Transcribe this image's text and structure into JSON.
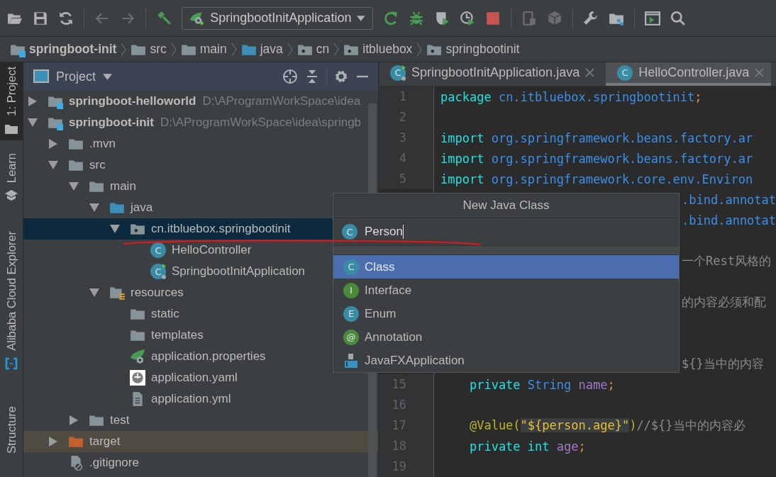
{
  "toolbar": [
    {
      "kind": "open",
      "disabled": false
    },
    {
      "kind": "save",
      "disabled": false
    },
    {
      "kind": "sync",
      "disabled": false
    },
    {
      "kind": "separator"
    },
    {
      "kind": "back",
      "disabled": true
    },
    {
      "kind": "forward",
      "disabled": true
    },
    {
      "kind": "separator"
    },
    {
      "kind": "build",
      "disabled": false
    },
    {
      "kind": "run-config",
      "label": "SpringbootInitApplication"
    },
    {
      "kind": "rerun",
      "disabled": false
    },
    {
      "kind": "debug",
      "disabled": false
    },
    {
      "kind": "coverage",
      "disabled": false
    },
    {
      "kind": "profile",
      "disabled": false
    },
    {
      "kind": "stop",
      "disabled": false
    },
    {
      "kind": "separator"
    },
    {
      "kind": "device",
      "disabled": true
    },
    {
      "kind": "package",
      "disabled": true
    },
    {
      "kind": "separator"
    },
    {
      "kind": "wrench",
      "disabled": false
    },
    {
      "kind": "structure",
      "disabled": false
    },
    {
      "kind": "separator"
    },
    {
      "kind": "terminal",
      "disabled": false
    },
    {
      "kind": "search",
      "disabled": false
    }
  ],
  "breadcrumbs": [
    {
      "label": "springboot-init",
      "kind": "module"
    },
    {
      "label": "src",
      "kind": "folder"
    },
    {
      "label": "main",
      "kind": "folder"
    },
    {
      "label": "java",
      "kind": "source-folder"
    },
    {
      "label": "cn",
      "kind": "package"
    },
    {
      "label": "itbluebox",
      "kind": "package"
    },
    {
      "label": "springbootinit",
      "kind": "package"
    }
  ],
  "tool_stripe": [
    {
      "label": "1: Project",
      "kind": "folder",
      "selected": true
    },
    {
      "label": "Learn",
      "kind": "learn",
      "selected": false
    },
    {
      "label": "Alibaba Cloud Explorer",
      "kind": "cloud",
      "selected": false
    },
    {
      "label": "Structure",
      "kind": "none",
      "selected": false
    }
  ],
  "project_panel": {
    "title": "Project",
    "tree": [
      {
        "label": "springboot-helloworld",
        "path": "D:\\AProgramWorkSpace\\idea",
        "kind": "module",
        "expanded": false,
        "selected": false
      },
      {
        "label": "springboot-init",
        "path": "D:\\AProgramWorkSpace\\idea\\springb",
        "kind": "module",
        "expanded": true,
        "selected": false,
        "children": [
          {
            "label": ".mvn",
            "kind": "folder",
            "expanded": false,
            "selected": false
          },
          {
            "label": "src",
            "kind": "folder",
            "expanded": true,
            "selected": false,
            "children": [
              {
                "label": "main",
                "kind": "folder",
                "expanded": true,
                "selected": false,
                "children": [
                  {
                    "label": "java",
                    "kind": "source-folder",
                    "expanded": true,
                    "selected": false,
                    "children": [
                      {
                        "label": "cn.itbluebox.springbootinit",
                        "kind": "package",
                        "expanded": true,
                        "selected": true,
                        "children": [
                          {
                            "label": "HelloController",
                            "kind": "class",
                            "icon_letter": "C",
                            "selected": false
                          },
                          {
                            "label": "SpringbootInitApplication",
                            "kind": "spring-class",
                            "icon_letter": "C",
                            "selected": false
                          }
                        ]
                      }
                    ]
                  },
                  {
                    "label": "resources",
                    "kind": "resources-folder",
                    "expanded": true,
                    "selected": false,
                    "children": [
                      {
                        "label": "static",
                        "kind": "folder",
                        "selected": false
                      },
                      {
                        "label": "templates",
                        "kind": "folder",
                        "selected": false
                      },
                      {
                        "label": "application.properties",
                        "kind": "spring-file",
                        "selected": false
                      },
                      {
                        "label": "application.yaml",
                        "kind": "image-file",
                        "selected": false
                      },
                      {
                        "label": "application.yml",
                        "kind": "text-file",
                        "selected": false
                      }
                    ]
                  }
                ]
              },
              {
                "label": "test",
                "kind": "folder",
                "expanded": false,
                "selected": false
              }
            ]
          },
          {
            "label": "target",
            "kind": "excluded-folder",
            "expanded": false,
            "selected": false
          },
          {
            "label": ".gitignore",
            "kind": "ignore-file",
            "selected": false
          }
        ]
      }
    ]
  },
  "editor": {
    "tabs": [
      {
        "label": "SpringbootInitApplication.java",
        "kind": "spring-class",
        "icon_letter": "C",
        "selected": false
      },
      {
        "label": "HelloController.java",
        "kind": "class",
        "icon_letter": "C",
        "selected": true
      }
    ],
    "lines": [
      {
        "number": "1",
        "tokens": [
          {
            "text": "package",
            "kind": "keyword"
          },
          {
            "text": " cn.itbluebox.springbootinit",
            "kind": "ident"
          },
          {
            "text": ";",
            "kind": "punct"
          }
        ]
      },
      {
        "number": "2"
      },
      {
        "number": "3",
        "tokens": [
          {
            "text": "import",
            "kind": "keyword"
          },
          {
            "text": " org.springframework.beans.factory.ar",
            "kind": "ident"
          }
        ]
      },
      {
        "number": "4",
        "tokens": [
          {
            "text": "import",
            "kind": "keyword"
          },
          {
            "text": " org.springframework.beans.factory.ar",
            "kind": "ident"
          }
        ]
      },
      {
        "number": "5",
        "tokens": [
          {
            "text": "import",
            "kind": "keyword"
          },
          {
            "text": " org.springframework.core.env.Environ",
            "kind": "ident"
          }
        ]
      },
      {
        "kind": "hidden",
        "tokens": [
          {
            "text": ".bind.annotat",
            "kind": "ident"
          }
        ]
      },
      {
        "kind": "hidden",
        "tokens": [
          {
            "text": ".bind.annotat",
            "kind": "ident"
          }
        ]
      },
      {
        "kind": "hidden"
      },
      {
        "kind": "hidden",
        "tokens": [
          {
            "text": "一个Rest风格的",
            "kind": "comment"
          }
        ]
      },
      {
        "kind": "hidden"
      },
      {
        "kind": "hidden",
        "tokens": [
          {
            "text": "的内容必须和配",
            "kind": "comment"
          }
        ]
      },
      {
        "kind": "hidden"
      },
      {
        "kind": "hidden"
      },
      {
        "kind": "hidden",
        "tokens": [
          {
            "text": "${}当中的内容",
            "kind": "comment"
          }
        ]
      },
      {
        "number": "15",
        "tokens": [
          {
            "text": "    private",
            "kind": "keyword"
          },
          {
            "text": " String",
            "kind": "ident"
          },
          {
            "text": " name",
            "kind": "field"
          },
          {
            "text": ";",
            "kind": "punct"
          }
        ]
      },
      {
        "number": "16"
      },
      {
        "number": "17",
        "tokens": [
          {
            "text": "    @Value(",
            "kind": "annotation"
          },
          {
            "text": "\"${person.age}\"",
            "kind": "string-match"
          },
          {
            "text": ")",
            "kind": "annotation"
          },
          {
            "text": "//${}当中的内容必",
            "kind": "comment"
          }
        ]
      },
      {
        "number": "18",
        "tokens": [
          {
            "text": "    private",
            "kind": "keyword"
          },
          {
            "text": " int",
            "kind": "keyword"
          },
          {
            "text": " age",
            "kind": "field"
          },
          {
            "text": ";",
            "kind": "punct"
          }
        ]
      },
      {
        "number": "19"
      }
    ]
  },
  "dialog": {
    "title": "New Java Class",
    "field": {
      "value": "Person",
      "icon_letter": "C"
    },
    "options": [
      {
        "label": "Class",
        "kind": "class",
        "icon_letter": "C",
        "selected": true
      },
      {
        "label": "Interface",
        "kind": "interface",
        "icon_letter": "I",
        "selected": false
      },
      {
        "label": "Enum",
        "kind": "enum",
        "icon_letter": "E",
        "selected": false
      },
      {
        "label": "Annotation",
        "kind": "annotation",
        "icon_letter": "@",
        "selected": false
      },
      {
        "label": "JavaFXApplication",
        "kind": "javafx",
        "selected": false
      }
    ]
  }
}
